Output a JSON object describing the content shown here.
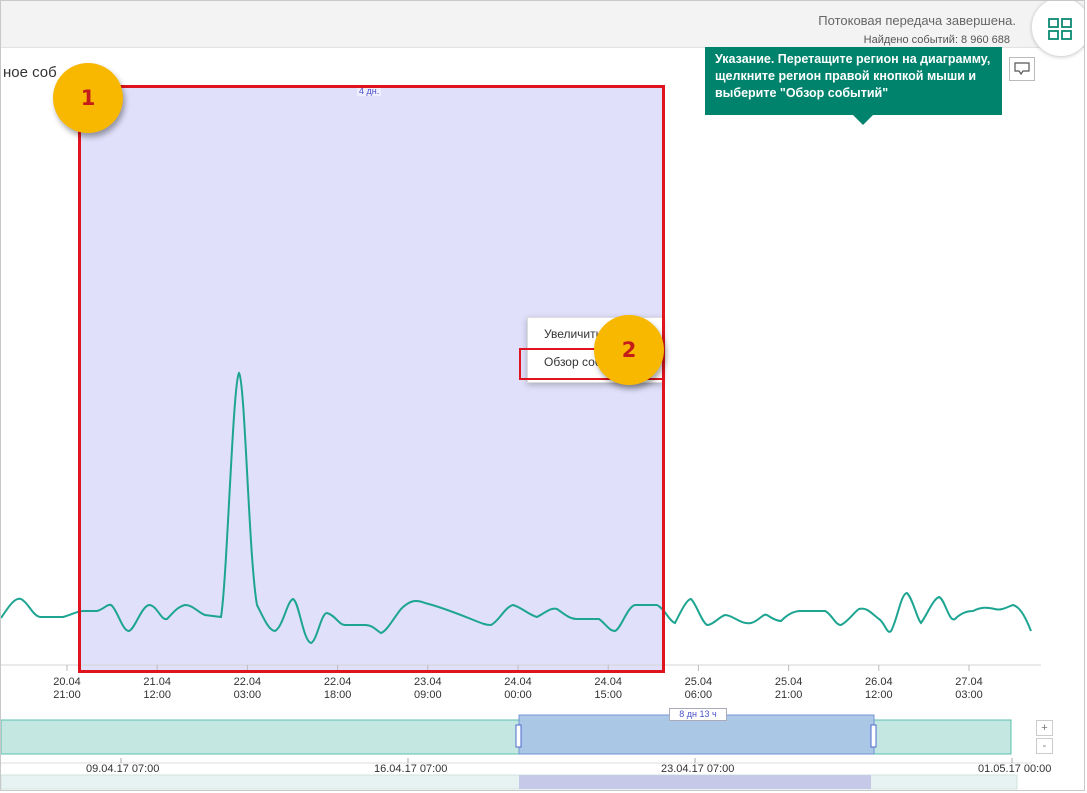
{
  "header": {
    "status": "Потоковая передача завершена.",
    "found_events": "Найдено событий: 8 960 688",
    "layout_icon": "grid-icon"
  },
  "chart_title": "ное соб",
  "tooltip": {
    "lines": [
      "Указание. Перетащите регион на диаграмму,",
      "щелкните регион правой кнопкой мыши и",
      "выберите \"Обзор событий\""
    ]
  },
  "comment_icon": "comment-icon",
  "selection": {
    "label": "4 дн."
  },
  "context_menu": {
    "zoom": "Увеличить",
    "overview": "Обзор событий"
  },
  "badges": [
    "1",
    "2"
  ],
  "colors": {
    "line": "#1ea592",
    "selection_fill": "#e0e0fb",
    "highlight": "#e0141e",
    "badge": "#f9b800",
    "tooltip": "#00836d"
  },
  "chart_data": {
    "type": "line",
    "x_ticks": [
      [
        "20.04",
        "21:00"
      ],
      [
        "21.04",
        "12:00"
      ],
      [
        "22.04",
        "03:00"
      ],
      [
        "22.04",
        "18:00"
      ],
      [
        "23.04",
        "09:00"
      ],
      [
        "24.04",
        "00:00"
      ],
      [
        "24.04",
        "15:00"
      ],
      [
        "25.04",
        "06:00"
      ],
      [
        "25.04",
        "21:00"
      ],
      [
        "26.04",
        "12:00"
      ],
      [
        "27.04",
        "03:00"
      ]
    ]
  },
  "navigator": {
    "selection_label": "8 дн 13 ч",
    "labels": [
      "09.04.17 07:00",
      "16.04.17 07:00",
      "23.04.17 07:00",
      "01.05.17 00:00"
    ],
    "zoom_in": "+",
    "zoom_out": "-"
  }
}
